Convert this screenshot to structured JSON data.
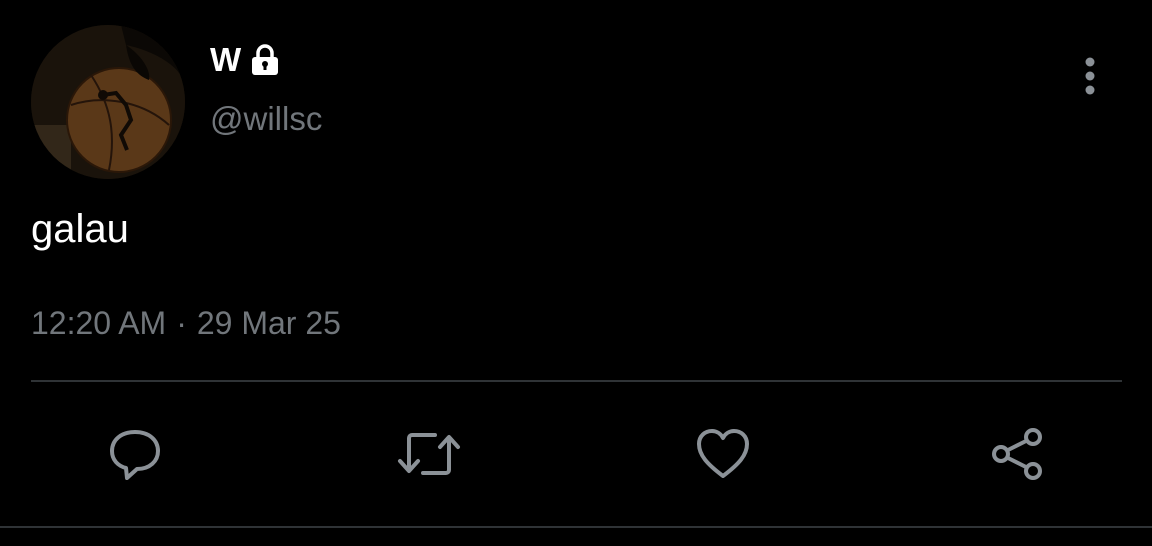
{
  "user": {
    "display_name": "W",
    "handle": "@willsc",
    "protected_icon": "lock-icon",
    "avatar": "basketball-photo"
  },
  "tweet": {
    "text": "galau",
    "time": "12:20 AM",
    "separator": "·",
    "date": "29 Mar 25"
  },
  "actions": [
    {
      "name": "reply",
      "icon": "comment-bubble-icon"
    },
    {
      "name": "retweet",
      "icon": "retweet-icon"
    },
    {
      "name": "like",
      "icon": "heart-icon"
    },
    {
      "name": "share",
      "icon": "share-icon"
    }
  ],
  "menu_icon": "more-vertical-icon",
  "colors": {
    "background": "#000000",
    "primary_text": "#ffffff",
    "secondary_text": "#71767b",
    "divider": "#2f3336"
  }
}
